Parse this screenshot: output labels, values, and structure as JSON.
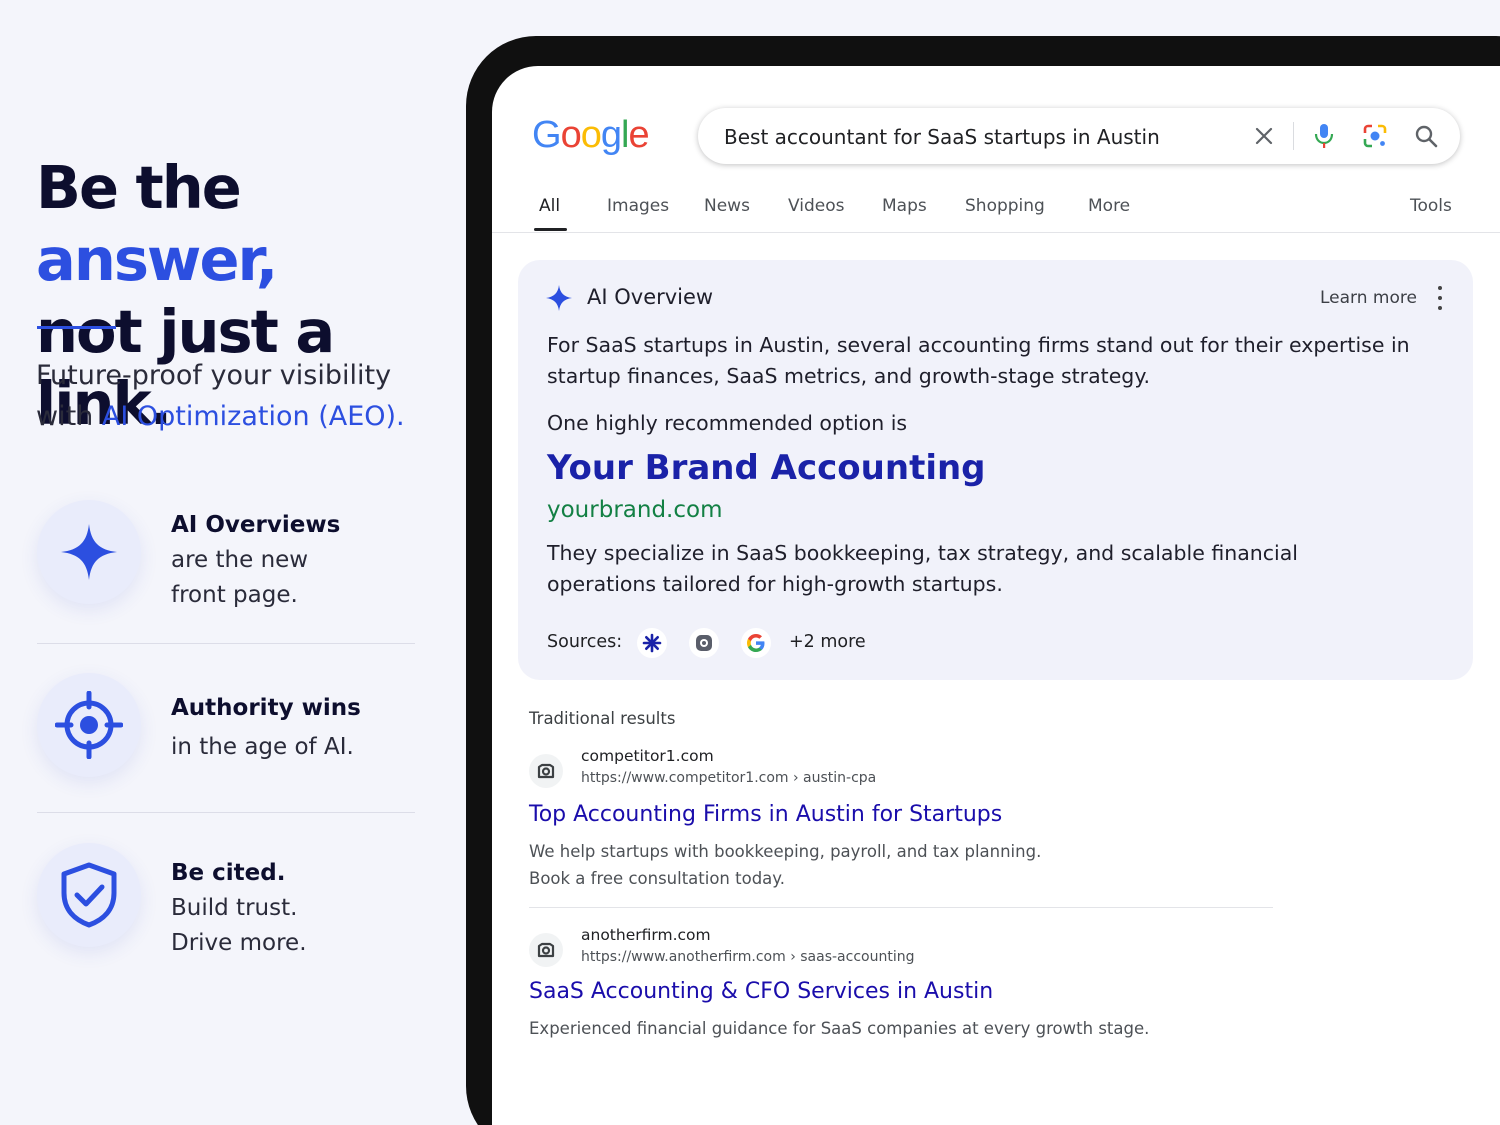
{
  "marketing": {
    "headline_part1": "Be the ",
    "headline_accent": "answer,",
    "headline_part2": "not just a link.",
    "tagline_part1": "Future-proof your visibility with ",
    "tagline_accent": "AI Optimization (AEO).",
    "features": [
      {
        "icon": "sparkle-icon",
        "bold": "AI Overviews",
        "line2": "are the new",
        "line3": "front page."
      },
      {
        "icon": "crosshair-icon",
        "bold": "Authority wins",
        "line2": "in the age of AI.",
        "line3": ""
      },
      {
        "icon": "shield-check-icon",
        "bold": "Be cited.",
        "line2": "Build trust.",
        "line3": "Drive more."
      }
    ],
    "accent_color": "#2c4fe0"
  },
  "search": {
    "logo_letters": [
      "G",
      "o",
      "o",
      "g",
      "l",
      "e"
    ],
    "query": "Best accountant for SaaS startups in Austin",
    "icons": [
      "close-icon",
      "mic-icon",
      "lens-icon",
      "search-icon"
    ]
  },
  "tabs": [
    "All",
    "Images",
    "News",
    "Videos",
    "Maps",
    "Shopping",
    "More",
    "Tools"
  ],
  "ai_overview": {
    "title": "AI Overview",
    "learn_more": "Learn more",
    "body": "For SaaS startups in Austin, several accounting firms stand out for their expertise in startup finances, SaaS metrics, and growth-stage strategy.",
    "lead": "One highly recommended option is",
    "brand": "Your Brand Accounting",
    "domain": "yourbrand.com",
    "description": "They specialize in SaaS bookkeeping, tax strategy, and scalable financial operations tailored for high-growth startups.",
    "sources_label": "Sources:",
    "sources_more": "+2 more"
  },
  "traditional": {
    "label": "Traditional results",
    "results": [
      {
        "site": "competitor1.com",
        "url": "https://www.competitor1.com › austin-cpa",
        "title": "Top Accounting Firms in Austin for Startups",
        "snippet_line1": "We help startups with bookkeeping, payroll, and tax planning.",
        "snippet_line2": "Book a free consultation today."
      },
      {
        "site": "anotherfirm.com",
        "url": "https://www.anotherfirm.com › saas-accounting",
        "title": "SaaS Accounting & CFO Services in Austin",
        "snippet_line1": "Experienced financial guidance for SaaS companies at every growth stage.",
        "snippet_line2": ""
      }
    ]
  }
}
